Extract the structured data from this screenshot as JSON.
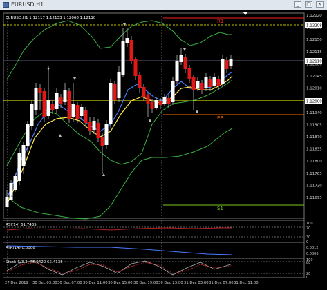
{
  "window": {
    "title": "EURUSD,H1",
    "buttons": {
      "minimize": "_",
      "maximize": "□",
      "close": "×"
    }
  },
  "main_panel": {
    "info": "EURUSD,H1  1.12117 1.12133 1.12068 1.12110",
    "price_ticks": [
      "1.12220",
      "1.12185",
      "1.12150",
      "1.12115",
      "1.12080",
      "1.12045",
      "1.12010",
      "1.11975",
      "1.11940",
      "1.11905",
      "1.11870",
      "1.11835",
      "1.11800",
      "1.11765",
      "1.11730",
      "1.11695"
    ],
    "price_labels": {
      "r1_level": "1.12208",
      "current": "1.12110",
      "pp_level": "1.12000"
    },
    "pivot_labels": {
      "r1": "R1",
      "pp": "PP",
      "s1": "S1"
    }
  },
  "rsi_panel": {
    "label": "RSI(14) 61.7435",
    "ticks": [
      "100",
      "70",
      "30",
      "0"
    ]
  },
  "atr_panel": {
    "label": "ATR(14) 0.0006",
    "ticks": [
      "0.0012",
      "0.0006"
    ]
  },
  "stoch_panel": {
    "label": "Stoch(5,3,3) 75.9420 65.4135",
    "ticks": [
      "100",
      "80",
      "20",
      "0"
    ]
  },
  "time_axis": {
    "labels": [
      "27 Dec 2019",
      "30 Dec 03:00",
      "30 Dec 07:00",
      "30 Dec 11:00",
      "30 Dec 15:00",
      "30 Dec 19:00",
      "30 Dec 23:00",
      "31 Dec 03:00",
      "31 Dec 07:00",
      "31 Dec 11:00"
    ]
  },
  "colors": {
    "background": "#000000",
    "bull_candle": "#ffffff",
    "bear_candle": "#e01818",
    "bollinger": "#3cb043",
    "ma_fast": "#4a7cff",
    "ma_slow": "#ffe650",
    "r1_line": "#ff2020",
    "pp_line": "#ff6a00",
    "s1_line": "#7ac81e",
    "support_line": "#ffff00",
    "grid": "#555555"
  }
}
